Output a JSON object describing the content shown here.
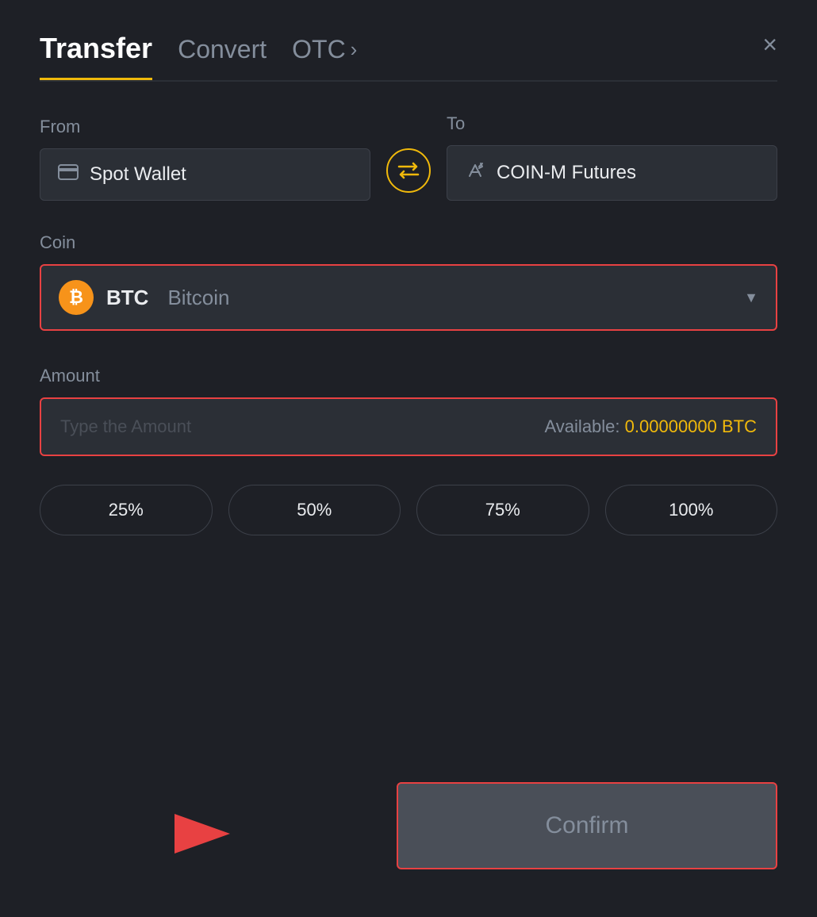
{
  "header": {
    "tab_transfer": "Transfer",
    "tab_convert": "Convert",
    "tab_otc": "OTC",
    "close_label": "×"
  },
  "from": {
    "label": "From",
    "wallet_text": "Spot Wallet"
  },
  "to": {
    "label": "To",
    "wallet_text": "COIN-M Futures"
  },
  "coin": {
    "label": "Coin",
    "symbol": "BTC",
    "name": "Bitcoin"
  },
  "amount": {
    "label": "Amount",
    "placeholder": "Type the Amount",
    "available_label": "Available:",
    "available_value": "0.00000000 BTC"
  },
  "percent_buttons": [
    "25%",
    "50%",
    "75%",
    "100%"
  ],
  "confirm": {
    "label": "Confirm"
  }
}
